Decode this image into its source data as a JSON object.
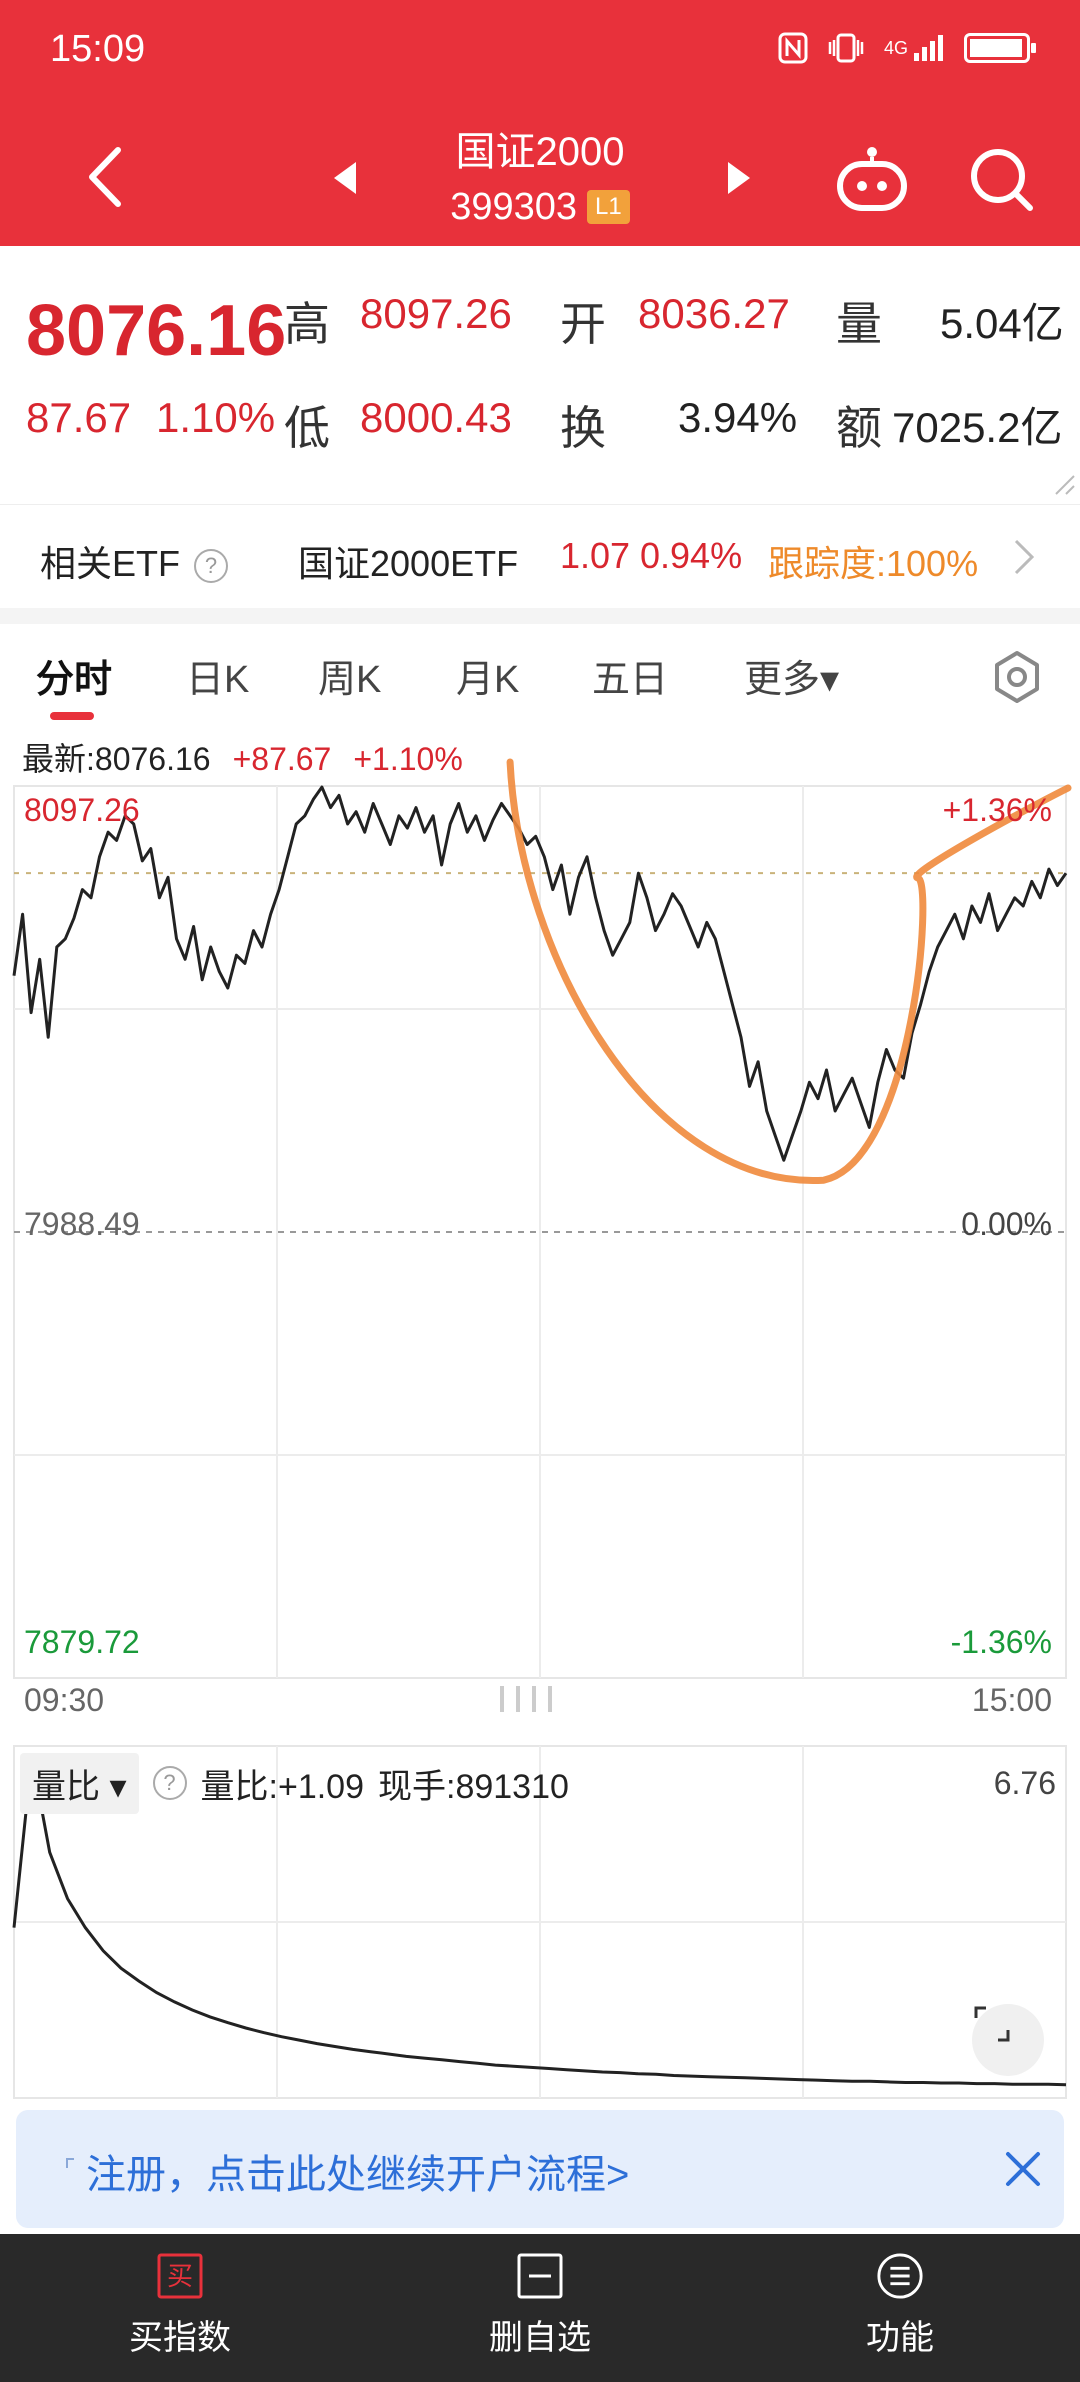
{
  "status_bar": {
    "time": "15:09",
    "network": "4G",
    "icons": [
      "nfc-icon",
      "vibrate-icon",
      "signal-icon",
      "battery-charging-icon"
    ]
  },
  "nav": {
    "title": "国证2000",
    "code": "399303",
    "level_badge": "L1"
  },
  "quote": {
    "price": "8076.16",
    "change": "87.67",
    "change_pct": "1.10%",
    "high_label": "高",
    "high": "8097.26",
    "open_label": "开",
    "open": "8036.27",
    "volume_label": "量",
    "volume": "5.04亿",
    "low_label": "低",
    "low": "8000.43",
    "turnover_label": "换",
    "turnover": "3.94%",
    "amount_label": "额",
    "amount": "7025.2亿"
  },
  "etf": {
    "label": "相关ETF",
    "help": "?",
    "name": "国证2000ETF",
    "price": "1.07",
    "change_pct": "0.94%",
    "tracking": "跟踪度:100%"
  },
  "tabs": [
    {
      "label": "分时",
      "active": true
    },
    {
      "label": "日K"
    },
    {
      "label": "周K"
    },
    {
      "label": "月K"
    },
    {
      "label": "五日"
    },
    {
      "label": "更多▾"
    }
  ],
  "chart_header": {
    "latest_label": "最新:8076.16",
    "change": "+87.67",
    "change_pct": "+1.10%"
  },
  "chart_data": {
    "type": "line",
    "title": "",
    "x_start": "09:30",
    "x_end": "15:00",
    "ylim": [
      7879.72,
      8097.26
    ],
    "prev_close": 7988.49,
    "y_labels": {
      "top": "8097.26",
      "mid": "7988.49",
      "bottom": "7879.72"
    },
    "pct_labels": {
      "top": "+1.36%",
      "mid": "0.00%",
      "bottom": "-1.36%"
    },
    "series": [
      {
        "values": [
          8051,
          8066,
          8042,
          8055,
          8036,
          8058,
          8060,
          8065,
          8072,
          8070,
          8080,
          8086,
          8084,
          8090,
          8088,
          8079,
          8082,
          8070,
          8075,
          8060,
          8055,
          8063,
          8050,
          8058,
          8052,
          8048,
          8056,
          8054,
          8062,
          8058,
          8066,
          8072,
          8080,
          8088,
          8090,
          8094,
          8097,
          8092,
          8095,
          8088,
          8091,
          8086,
          8093,
          8088,
          8083,
          8090,
          8087,
          8092,
          8086,
          8090,
          8078,
          8088,
          8093,
          8086,
          8090,
          8084,
          8089,
          8093,
          8090,
          8087,
          8083,
          8085,
          8080,
          8072,
          8078,
          8066,
          8075,
          8080,
          8070,
          8062,
          8056,
          8060,
          8064,
          8076,
          8070,
          8062,
          8066,
          8071,
          8068,
          8063,
          8058,
          8064,
          8060,
          8052,
          8044,
          8036,
          8024,
          8030,
          8018,
          8012,
          8006,
          8012,
          8018,
          8025,
          8021,
          8028,
          8018,
          8022,
          8026,
          8020,
          8014,
          8025,
          8033,
          8028,
          8026,
          8037,
          8044,
          8052,
          8058,
          8062,
          8066,
          8060,
          8068,
          8064,
          8071,
          8062,
          8066,
          8070,
          8068,
          8074,
          8070,
          8077,
          8073,
          8076
        ]
      }
    ],
    "volume_ratio": {
      "label": "量比",
      "help": "?",
      "current_label": "量比:+1.09",
      "shares_label": "现手:891310",
      "max_label": "6.76",
      "values": [
        3.8,
        6.76,
        5.1,
        4.3,
        3.8,
        3.4,
        3.1,
        2.88,
        2.68,
        2.52,
        2.38,
        2.26,
        2.16,
        2.07,
        1.99,
        1.92,
        1.86,
        1.8,
        1.75,
        1.7,
        1.66,
        1.62,
        1.58,
        1.55,
        1.52,
        1.49,
        1.46,
        1.43,
        1.41,
        1.39,
        1.37,
        1.35,
        1.33,
        1.31,
        1.3,
        1.28,
        1.27,
        1.25,
        1.24,
        1.23,
        1.22,
        1.21,
        1.2,
        1.19,
        1.18,
        1.17,
        1.16,
        1.15,
        1.15,
        1.14,
        1.13,
        1.13,
        1.12,
        1.12,
        1.11,
        1.11,
        1.1,
        1.1,
        1.1,
        1.09
      ]
    },
    "annotation_color": "#f08a3c"
  },
  "banner": {
    "text": "注册，点击此处继续开户流程>"
  },
  "bottom_bar": [
    {
      "label": "买指数",
      "icon_text": "买"
    },
    {
      "label": "删自选",
      "icon_text": "一"
    },
    {
      "label": "功能",
      "icon_text": "三"
    }
  ],
  "colors": {
    "header": "#e8313b",
    "up": "#d8262f",
    "down": "#1a9a3a",
    "etf_tracking": "#ee8a2a",
    "banner_text": "#2d6fd8"
  }
}
